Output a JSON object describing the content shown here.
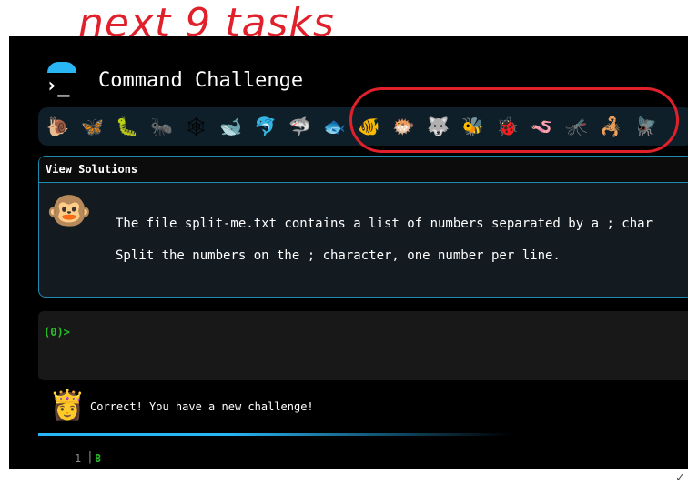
{
  "annotation": {
    "text": "next 9 tasks",
    "color": "#e0202a"
  },
  "app": {
    "title": "Command Challenge",
    "logo_glyph": "›_"
  },
  "icon_strip": {
    "icons": [
      {
        "name": "snail-icon",
        "glyph": "🐌"
      },
      {
        "name": "butterfly-icon",
        "glyph": "🦋"
      },
      {
        "name": "caterpillar-icon",
        "glyph": "🐛"
      },
      {
        "name": "ant-icon",
        "glyph": "🐜"
      },
      {
        "name": "spider-web-icon",
        "glyph": "🕸"
      },
      {
        "name": "whale-icon",
        "glyph": "🐋"
      },
      {
        "name": "dolphin-icon",
        "glyph": "🐬"
      },
      {
        "name": "shark-icon",
        "glyph": "🦈"
      },
      {
        "name": "fish-icon",
        "glyph": "🐟"
      },
      {
        "name": "tropical-fish-icon",
        "glyph": "🐠"
      },
      {
        "name": "blowfish-icon",
        "glyph": "🐡"
      },
      {
        "name": "wolf-icon",
        "glyph": "🐺"
      },
      {
        "name": "bee-icon",
        "glyph": "🐝"
      },
      {
        "name": "ladybug-icon",
        "glyph": "🐞"
      },
      {
        "name": "worm-icon",
        "glyph": "🪱"
      },
      {
        "name": "mosquito-icon",
        "glyph": "🦟"
      },
      {
        "name": "scorpion-icon",
        "glyph": "🦂"
      },
      {
        "name": "fly-icon",
        "glyph": "🪰"
      }
    ]
  },
  "solutions": {
    "header": "View Solutions",
    "description_line1": "The file split-me.txt contains a list of numbers separated by a ; char",
    "description_line2": "Split the numbers on the ; character, one number per line."
  },
  "terminal": {
    "prompt": "(0)>"
  },
  "status": {
    "message": "Correct! You have a new challenge!"
  },
  "output": {
    "line_number": "1",
    "separator": "|",
    "value": "8"
  },
  "colors": {
    "accent": "#29b6f6",
    "prompt_green": "#25c025",
    "border": "#1e8ab0"
  }
}
